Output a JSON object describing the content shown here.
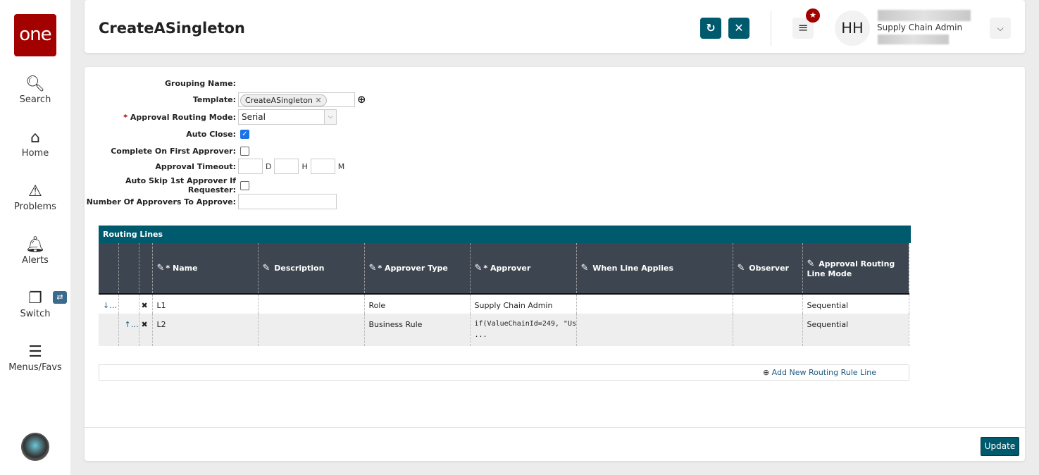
{
  "sidebar": {
    "logo": "one",
    "items": [
      {
        "label": "Search"
      },
      {
        "label": "Home"
      },
      {
        "label": "Problems"
      },
      {
        "label": "Alerts"
      },
      {
        "label": "Switch"
      },
      {
        "label": "Menus/Favs"
      }
    ]
  },
  "header": {
    "title": "CreateASingleton",
    "user_initials": "HH",
    "user_role": "Supply Chain Admin"
  },
  "form": {
    "grouping_name_label": "Grouping Name:",
    "template_label": "Template:",
    "template_value": "CreateASingleton",
    "routing_mode_label": "Approval Routing Mode:",
    "routing_mode_value": "Serial",
    "auto_close_label": "Auto Close:",
    "auto_close": true,
    "complete_first_label": "Complete On First Approver:",
    "complete_first": false,
    "timeout_label": "Approval Timeout:",
    "unit_d": "D",
    "unit_h": "H",
    "unit_m": "M",
    "auto_skip_label": "Auto Skip 1st Approver If Requester:",
    "auto_skip": false,
    "num_approvers_label": "Number Of Approvers To Approve:"
  },
  "grid": {
    "title": "Routing Lines",
    "columns": [
      "Name",
      "Description",
      "Approver Type",
      "Approver",
      "When Line Applies",
      "Observer",
      "Approval Routing Line Mode"
    ],
    "rows": [
      {
        "name": "L1",
        "description": "",
        "approver_type": "Role",
        "approver": "Supply Chain Admin",
        "when": "",
        "observer": "",
        "mode": "Sequential"
      },
      {
        "name": "L2",
        "description": "",
        "approver_type": "Business Rule",
        "approver": "if(ValueChainId=249, \"Us",
        "approver_more": "...",
        "when": "",
        "observer": "",
        "mode": "Sequential"
      }
    ],
    "add_label": "Add New Routing Rule Line"
  },
  "footer": {
    "update_label": "Update"
  }
}
